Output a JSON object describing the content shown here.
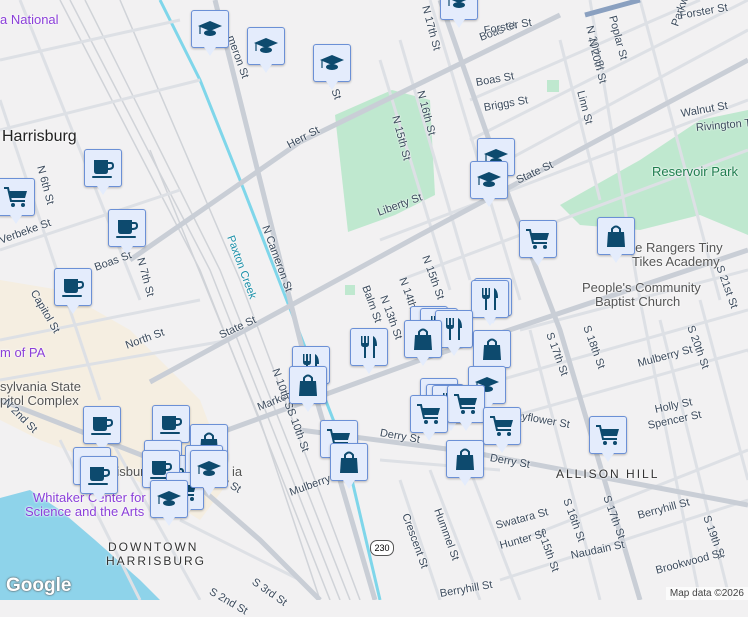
{
  "map": {
    "city_label": "Harrisburg",
    "neighborhoods": [
      "DOWNTOWN",
      "HARRISBURG",
      "ALLISON HILL"
    ],
    "parks": [
      "Reservoir Park"
    ],
    "pois": [
      "a National",
      "m of PA",
      "sylvania State",
      "pitol Complex",
      "Whitaker Center for",
      "Science and the Arts",
      "The Rangers Tiny",
      "Tikes Academy",
      "People's Community",
      "Baptist Church",
      "risburg",
      "ia"
    ],
    "waterways": [
      "Paxton Creek"
    ],
    "highway_shield": "230",
    "streets": [
      "Herr St",
      "N Cameron St",
      "meron St",
      "N 14th St",
      "N 15th St",
      "N 16th St",
      "N 17th St",
      "N 20th St",
      "Poplar St",
      "Parkway D",
      "Forster St",
      "Boas St",
      "Briggs St",
      "Walnut St",
      "Rivington T",
      "State St",
      "Liberty St",
      "N 13th St",
      "N 14th St",
      "N 15th St",
      "Balm St",
      "N 6th St",
      "N 7th St",
      "Boas St",
      "Capitol St",
      "North St",
      "State St",
      "N 2nd St",
      "Market St",
      "N 10th St",
      "S 10th St",
      "Mulberry St",
      "Derry St",
      "Derry St",
      "Mulberry St",
      "Holly St",
      "Spencer St",
      "Mayflower St",
      "S 17th St",
      "S 18th St",
      "S 20th St",
      "S 21st St",
      "S 17th St",
      "S 16th St",
      "S 15th St",
      "S 19th St",
      "Swatara St",
      "Hunter St",
      "Naudain St",
      "Berryhill St",
      "Brookwood St",
      "Crescent St",
      "Hummel St",
      "Berryhill St",
      "S 3rd St",
      "S 2nd St",
      "Boas St",
      "N 20th St",
      "Linn St",
      "Forster St",
      "Verbeke St",
      "4th St"
    ]
  },
  "icons": {
    "school": "school-icon",
    "cafe": "cafe-icon",
    "grocery": "grocery-cart-icon",
    "shopping": "shopping-bag-icon",
    "restaurant": "restaurant-icon"
  },
  "attribution": {
    "logo": "Google",
    "credit": "Map data ©2026"
  },
  "colors": {
    "marker_bg": "#e4ecfc",
    "marker_border": "#6b90d6",
    "icon": "#0d4a6e",
    "park": "#bfe8cf",
    "water": "#8ed3ea",
    "creek": "#7fd6ea"
  }
}
